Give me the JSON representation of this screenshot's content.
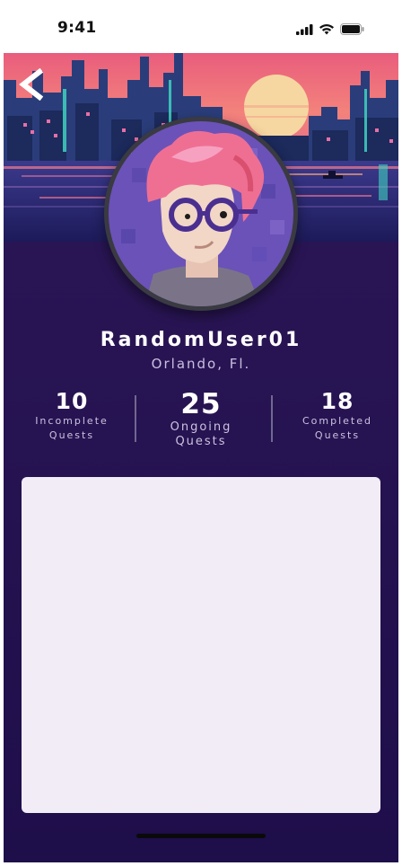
{
  "status_bar": {
    "time": "9:41",
    "icons": [
      "cellular-signal-icon",
      "wifi-icon",
      "battery-icon"
    ]
  },
  "header": {
    "back_icon": "chevron-left-icon"
  },
  "profile": {
    "username": "RandomUser01",
    "location": "Orlando, Fl."
  },
  "stats": [
    {
      "value": "10",
      "label_line1": "Incomplete",
      "label_line2": "Quests"
    },
    {
      "value": "25",
      "label_line1": "Ongoing",
      "label_line2": "Quests"
    },
    {
      "value": "18",
      "label_line1": "Completed",
      "label_line2": "Quests"
    }
  ],
  "colors": {
    "background": "#281453",
    "card": "#f1ecf6",
    "sky": "#f0727e",
    "sun": "#f4d9a0"
  }
}
